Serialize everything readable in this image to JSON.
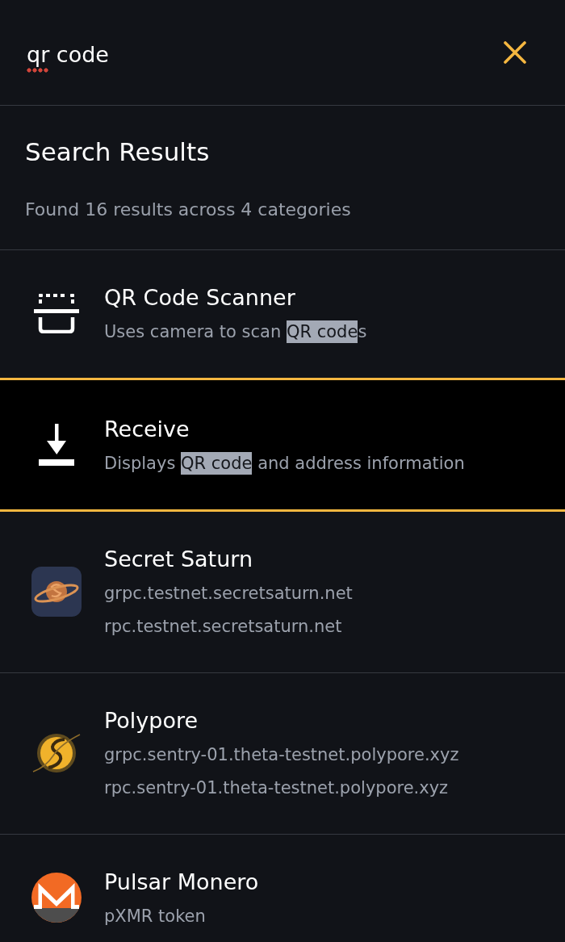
{
  "search": {
    "parts": [
      {
        "text": "qr",
        "misspelled": true
      },
      {
        "text": " code",
        "misspelled": false
      }
    ]
  },
  "heading": {
    "title": "Search Results",
    "summary": "Found 16 results across 4 categories"
  },
  "results": [
    {
      "kind": "scanner",
      "title": "QR Code Scanner",
      "selected": false,
      "lines": [
        [
          {
            "text": "Uses camera to scan ",
            "highlighted": false
          },
          {
            "text": "QR code",
            "highlighted": true
          },
          {
            "text": "s",
            "highlighted": false
          }
        ]
      ]
    },
    {
      "kind": "receive",
      "title": "Receive",
      "selected": true,
      "lines": [
        [
          {
            "text": "Displays ",
            "highlighted": false
          },
          {
            "text": "QR code",
            "highlighted": true
          },
          {
            "text": " and address information",
            "highlighted": false
          }
        ]
      ]
    },
    {
      "kind": "saturn",
      "title": "Secret Saturn",
      "selected": false,
      "lines": [
        [
          {
            "text": "grpc.testnet.secretsaturn.net",
            "highlighted": false
          }
        ],
        [
          {
            "text": "rpc.testnet.secretsaturn.net",
            "highlighted": false
          }
        ]
      ]
    },
    {
      "kind": "polypore",
      "title": "Polypore",
      "selected": false,
      "lines": [
        [
          {
            "text": "grpc.sentry-01.theta-testnet.polypore.xyz",
            "highlighted": false
          }
        ],
        [
          {
            "text": "rpc.sentry-01.theta-testnet.polypore.xyz",
            "highlighted": false
          }
        ]
      ]
    },
    {
      "kind": "monero",
      "title": "Pulsar Monero",
      "selected": false,
      "lines": [
        [
          {
            "text": "pXMR token",
            "highlighted": false
          }
        ]
      ]
    }
  ]
}
